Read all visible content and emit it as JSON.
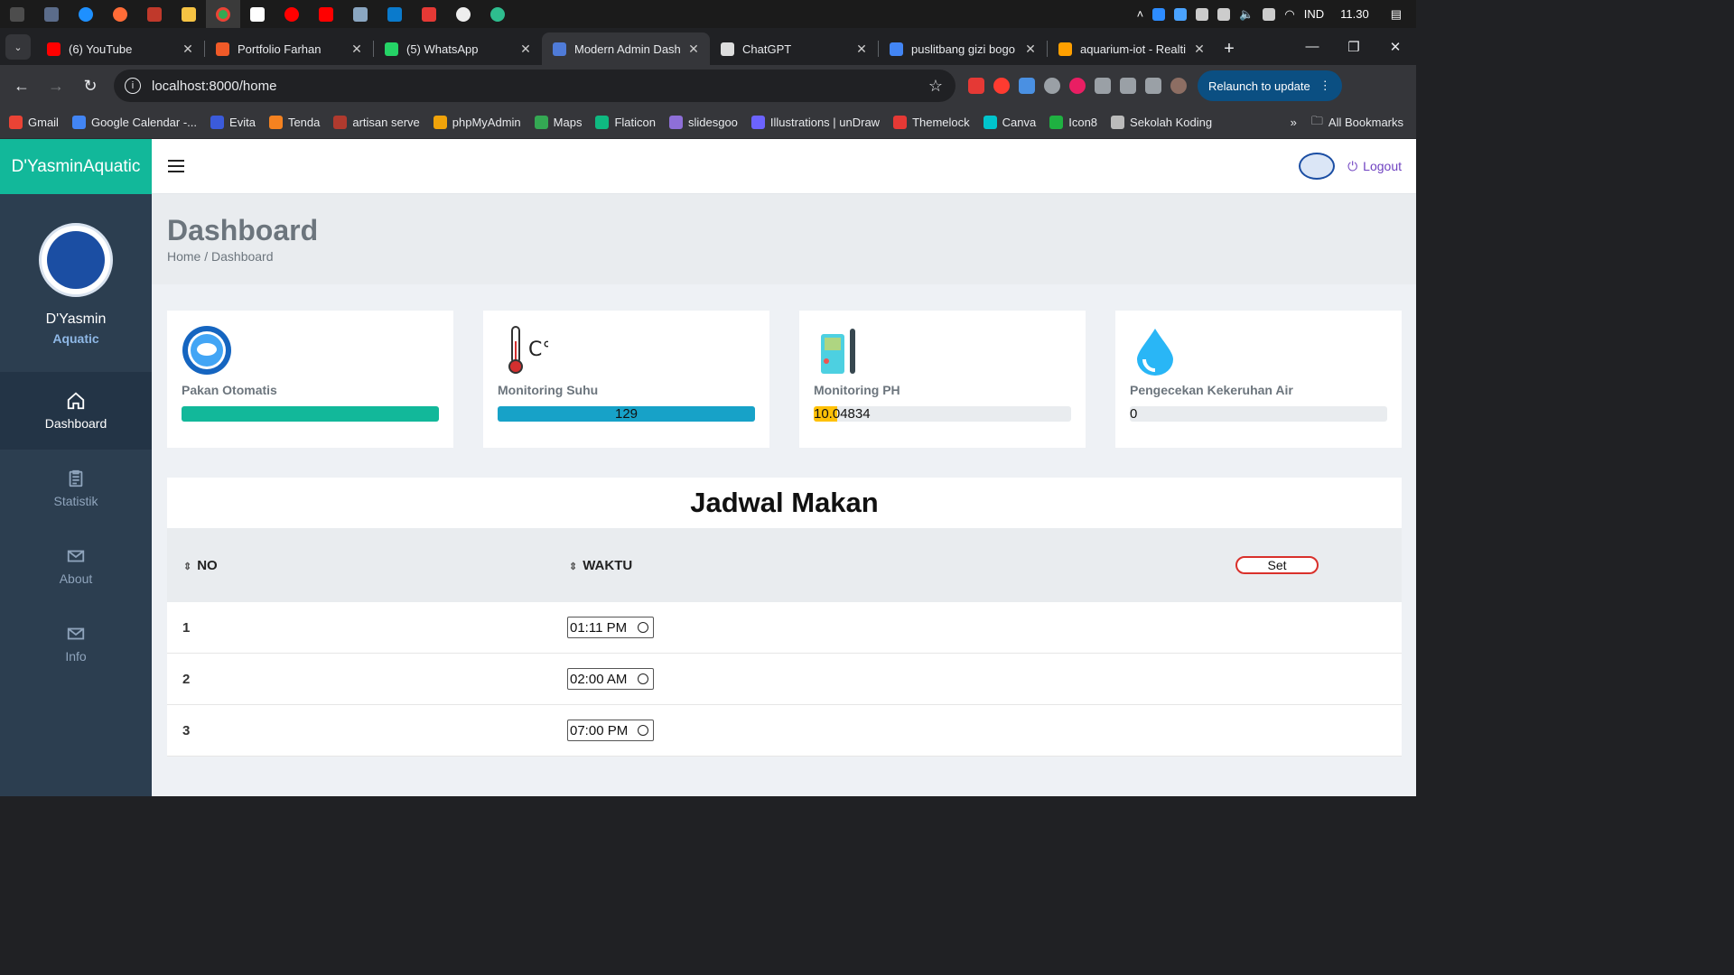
{
  "taskbar": {
    "tray": {
      "lang": "IND",
      "time": "11.30"
    }
  },
  "tabs": [
    {
      "title": "(6) YouTube",
      "color": "#ff0000"
    },
    {
      "title": "Portfolio Farhan",
      "color": "#f05a28"
    },
    {
      "title": "(5) WhatsApp",
      "color": "#25d366"
    },
    {
      "title": "Modern Admin Dash",
      "color": "#4f7bd8",
      "active": true
    },
    {
      "title": "ChatGPT",
      "color": "#dddddd"
    },
    {
      "title": "puslitbang gizi bogo",
      "color": "#4285f4"
    },
    {
      "title": "aquarium-iot - Realti",
      "color": "#ffa000"
    }
  ],
  "toolbar": {
    "url": "localhost:8000/home",
    "relaunch_label": "Relaunch to update"
  },
  "bookmarks": [
    {
      "label": "Gmail",
      "color": "#ea4335"
    },
    {
      "label": "Google Calendar -...",
      "color": "#4285f4"
    },
    {
      "label": "Evita",
      "color": "#3b5bdb"
    },
    {
      "label": "Tenda",
      "color": "#f58220"
    },
    {
      "label": "artisan serve",
      "color": "#b03a2e"
    },
    {
      "label": "phpMyAdmin",
      "color": "#f0a30a"
    },
    {
      "label": "Maps",
      "color": "#34a853"
    },
    {
      "label": "Flaticon",
      "color": "#0fb981"
    },
    {
      "label": "slidesgoo",
      "color": "#8e6fd8"
    },
    {
      "label": "Illustrations | unDraw",
      "color": "#6c63ff"
    },
    {
      "label": "Themelock",
      "color": "#e53935"
    },
    {
      "label": "Canva",
      "color": "#00c4cc"
    },
    {
      "label": "Icon8",
      "color": "#1fb141"
    },
    {
      "label": "Sekolah Koding",
      "color": "#bbbbbb"
    }
  ],
  "bookmarks_right": {
    "more": "»",
    "all": "All Bookmarks"
  },
  "sidebar": {
    "brand": "D'YasminAquatic",
    "profile_name": "D'Yasmin",
    "profile_sub": "Aquatic",
    "items": [
      {
        "label": "Dashboard",
        "icon": "home-icon",
        "active": true
      },
      {
        "label": "Statistik",
        "icon": "clipboard-icon"
      },
      {
        "label": "About",
        "icon": "mail-icon"
      },
      {
        "label": "Info",
        "icon": "mail-icon"
      }
    ]
  },
  "topbar": {
    "logout_label": "Logout"
  },
  "header": {
    "title": "Dashboard",
    "breadcrumb": "Home / Dashboard"
  },
  "cards": [
    {
      "label": "Pakan Otomatis",
      "icon": "fish-feeder-icon",
      "value": "",
      "progress": 1.0,
      "color": "#12b89a"
    },
    {
      "label": "Monitoring Suhu",
      "icon": "thermometer-icon",
      "value": "129",
      "progress": 1.0,
      "color": "#17a2c8"
    },
    {
      "label": "Monitoring PH",
      "icon": "ph-meter-icon",
      "value": "10.04834",
      "progress": 0.09,
      "color": "#ffc107"
    },
    {
      "label": "Pengecekan Kekeruhan Air",
      "icon": "water-drop-icon",
      "value": "0",
      "progress": 0,
      "color": "#17a2c8"
    }
  ],
  "schedule": {
    "title": "Jadwal Makan",
    "col_no": "NO",
    "col_waktu": "WAKTU",
    "set_label": "Set",
    "rows": [
      {
        "no": "1",
        "time": "01:11 PM"
      },
      {
        "no": "2",
        "time": "02:00 AM"
      },
      {
        "no": "3",
        "time": "07:00 PM"
      }
    ]
  }
}
